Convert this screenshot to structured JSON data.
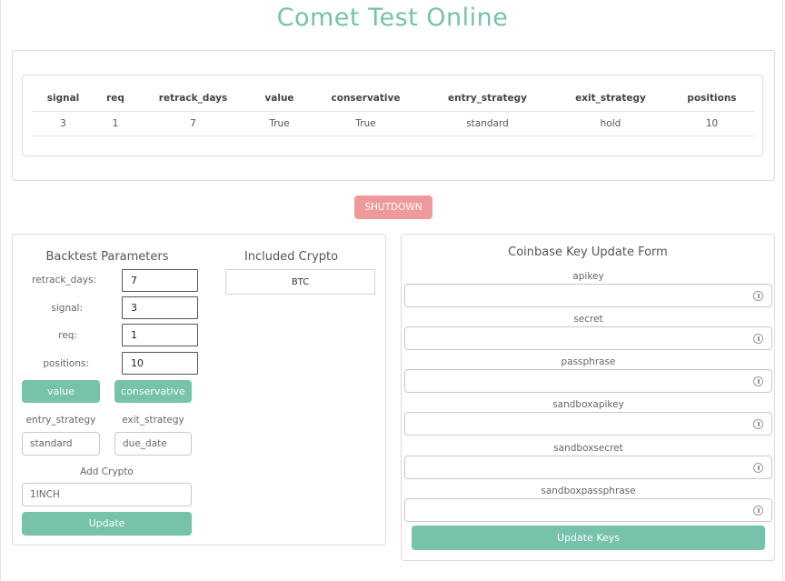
{
  "app": {
    "title": "Comet Test Online"
  },
  "status_table": {
    "columns": [
      "signal",
      "req",
      "retrack_days",
      "value",
      "conservative",
      "entry_strategy",
      "exit_strategy",
      "positions"
    ],
    "row": [
      "3",
      "1",
      "7",
      "True",
      "True",
      "standard",
      "hold",
      "10"
    ]
  },
  "shutdown_label": "SHUTDOWN",
  "backtest": {
    "title": "Backtest Parameters",
    "retrack_days_label": "retrack_days:",
    "retrack_days_value": "7",
    "signal_label": "signal:",
    "signal_value": "3",
    "req_label": "req:",
    "req_value": "1",
    "positions_label": "positions:",
    "positions_value": "10",
    "value_button": "value",
    "conservative_button": "conservative",
    "entry_strategy_label": "entry_strategy",
    "entry_strategy_value": "standard",
    "exit_strategy_label": "exit_strategy",
    "exit_strategy_value": "due_date",
    "add_crypto_label": "Add Crypto",
    "add_crypto_value": "1INCH",
    "update_button": "Update"
  },
  "included": {
    "title": "Included Crypto",
    "items": [
      "BTC"
    ]
  },
  "coinbase": {
    "title": "Coinbase Key Update Form",
    "fields": [
      "apikey",
      "secret",
      "passphrase",
      "sandboxapikey",
      "sandboxsecret",
      "sandboxpassphrase"
    ],
    "update_button": "Update Keys"
  },
  "colors": {
    "accent": "#76c2ab",
    "danger": "#ee9a9a"
  },
  "icons": {
    "key_field_icon": "password-reveal-icon"
  }
}
